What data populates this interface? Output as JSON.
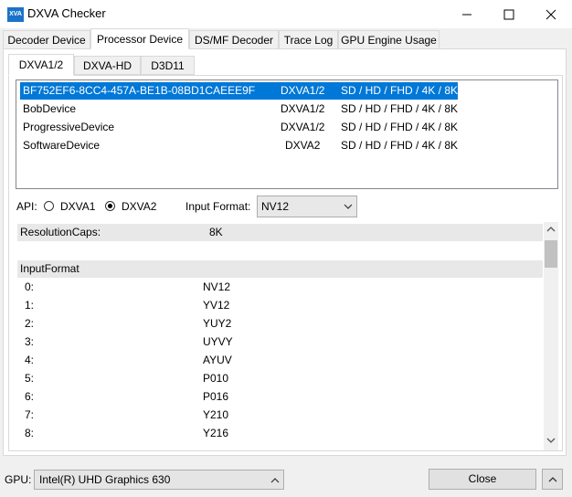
{
  "window": {
    "title": "DXVA Checker",
    "icon_text": "XVA"
  },
  "main_tabs": [
    {
      "label": "Decoder Device"
    },
    {
      "label": "Processor Device"
    },
    {
      "label": "DS/MF Decoder"
    },
    {
      "label": "Trace Log"
    },
    {
      "label": "GPU Engine Usage"
    }
  ],
  "sub_tabs": [
    {
      "label": "DXVA1/2"
    },
    {
      "label": "DXVA-HD"
    },
    {
      "label": "D3D11"
    }
  ],
  "devices": [
    {
      "name": "BF752EF6-8CC4-457A-BE1B-08BD1CAEEE9F",
      "api": "DXVA1/2",
      "res": "SD / HD / FHD / 4K / 8K",
      "selected": true
    },
    {
      "name": "BobDevice",
      "api": "DXVA1/2",
      "res": "SD / HD / FHD / 4K / 8K"
    },
    {
      "name": "ProgressiveDevice",
      "api": "DXVA1/2",
      "res": "SD / HD / FHD / 4K / 8K"
    },
    {
      "name": "SoftwareDevice",
      "api": "DXVA2",
      "res": "SD / HD / FHD / 4K / 8K"
    }
  ],
  "controls": {
    "api_label": "API:",
    "dxva1_label": "DXVA1",
    "dxva2_label": "DXVA2",
    "input_format_label": "Input Format:",
    "input_format_value": "NV12"
  },
  "caps": {
    "resolution_label": "ResolutionCaps:",
    "resolution_value": "8K",
    "input_format_header": "InputFormat",
    "formats": [
      {
        "idx": "0:",
        "val": "NV12"
      },
      {
        "idx": "1:",
        "val": "YV12"
      },
      {
        "idx": "2:",
        "val": "YUY2"
      },
      {
        "idx": "3:",
        "val": "UYVY"
      },
      {
        "idx": "4:",
        "val": "AYUV"
      },
      {
        "idx": "5:",
        "val": "P010"
      },
      {
        "idx": "6:",
        "val": "P016"
      },
      {
        "idx": "7:",
        "val": "Y210"
      },
      {
        "idx": "8:",
        "val": "Y216"
      }
    ]
  },
  "bottom": {
    "gpu_label": "GPU:",
    "gpu_value": "Intel(R) UHD Graphics 630",
    "close_label": "Close"
  },
  "colors": {
    "selection": "#0078d7",
    "accent_icon": "#1a73c8"
  }
}
